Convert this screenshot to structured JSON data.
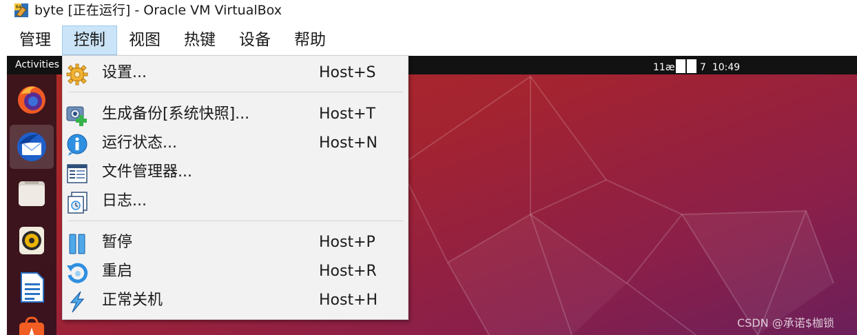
{
  "window": {
    "title": "byte [正在运行] - Oracle VM VirtualBox",
    "app_icon": "virtualbox-icon"
  },
  "menubar": {
    "items": [
      {
        "label": "管理"
      },
      {
        "label": "控制",
        "active": true
      },
      {
        "label": "视图"
      },
      {
        "label": "热键"
      },
      {
        "label": "设备"
      },
      {
        "label": "帮助"
      }
    ]
  },
  "vm": {
    "activities": "Activities",
    "clock_prefix": "11æ",
    "clock_day": "7",
    "clock_time": "10:49",
    "dock_icons": [
      "firefox-icon",
      "thunderbird-icon",
      "files-icon",
      "rhythmbox-icon",
      "libreoffice-writer-icon",
      "software-store-icon"
    ],
    "wallpaper_colors": [
      "#b02c24",
      "#a32331",
      "#8a1f4a",
      "#6b1f5a"
    ]
  },
  "dropdown": {
    "items": [
      {
        "label": "设置...",
        "shortcut": "Host+S",
        "icon": "gear-icon"
      },
      {
        "label": "生成备份[系统快照]...",
        "shortcut": "Host+T",
        "icon": "snapshot-add-icon"
      },
      {
        "label": "运行状态...",
        "shortcut": "Host+N",
        "icon": "info-icon"
      },
      {
        "label": "文件管理器...",
        "shortcut": "",
        "icon": "file-manager-icon"
      },
      {
        "label": "日志...",
        "shortcut": "",
        "icon": "log-icon"
      },
      {
        "label": "暂停",
        "shortcut": "Host+P",
        "icon": "pause-icon"
      },
      {
        "label": "重启",
        "shortcut": "Host+R",
        "icon": "reset-icon"
      },
      {
        "label": "正常关机",
        "shortcut": "Host+H",
        "icon": "power-off-icon"
      }
    ]
  },
  "watermark": "CSDN @承诺$枷锁",
  "colors": {
    "menu_active_bg": "#cce4f7",
    "dropdown_bg": "#f2f2f2",
    "gnome_topbar": "#121212"
  }
}
